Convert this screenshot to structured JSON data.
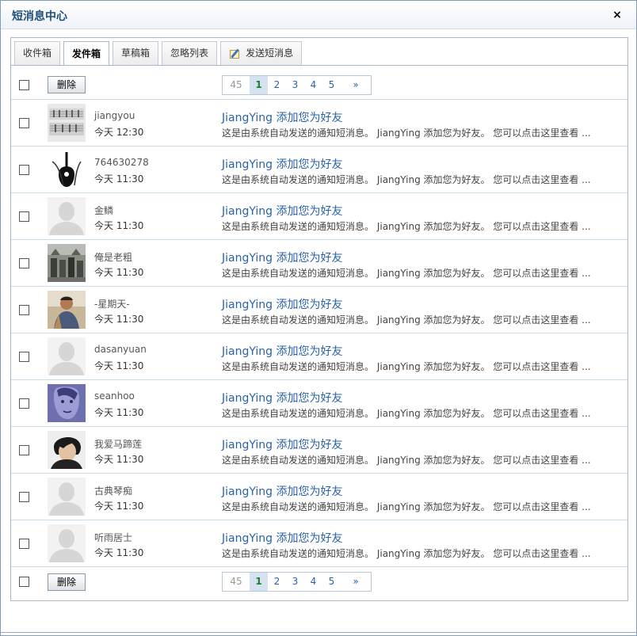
{
  "window": {
    "title": "短消息中心",
    "close_label": "×"
  },
  "tabs": [
    {
      "label": "收件箱",
      "active": false
    },
    {
      "label": "发件箱",
      "active": true
    },
    {
      "label": "草稿箱",
      "active": false
    },
    {
      "label": "忽略列表",
      "active": false
    },
    {
      "label": "发送短消息",
      "active": false,
      "icon": "compose-icon"
    }
  ],
  "toolbar": {
    "delete_label": "删除"
  },
  "pager": {
    "total": "45",
    "pages": [
      "1",
      "2",
      "3",
      "4",
      "5"
    ],
    "current": "1",
    "next_label": "»"
  },
  "messages": [
    {
      "avatar": "photo-sheet-music",
      "username": "jiangyou",
      "time": "今天 12:30",
      "subject": "JiangYing 添加您为好友",
      "snippet": "这是由系统自动发送的通知短消息。 JiangYing 添加您为好友。 您可以点击这里查看 ..."
    },
    {
      "avatar": "photo-guitar",
      "username": "764630278",
      "time": "今天 11:30",
      "subject": "JiangYing 添加您为好友",
      "snippet": "这是由系统自动发送的通知短消息。 JiangYing 添加您为好友。 您可以点击这里查看 ..."
    },
    {
      "avatar": "default-avatar",
      "username": "金鳞",
      "time": "今天 11:30",
      "subject": "JiangYing 添加您为好友",
      "snippet": "这是由系统自动发送的通知短消息。 JiangYing 添加您为好友。 您可以点击这里查看 ..."
    },
    {
      "avatar": "photo-group",
      "username": "俺是老粗",
      "time": "今天 11:30",
      "subject": "JiangYing 添加您为好友",
      "snippet": "这是由系统自动发送的通知短消息。 JiangYing 添加您为好友。 您可以点击这里查看 ..."
    },
    {
      "avatar": "photo-person",
      "username": "-星期天-",
      "time": "今天 11:30",
      "subject": "JiangYing 添加您为好友",
      "snippet": "这是由系统自动发送的通知短消息。 JiangYing 添加您为好友。 您可以点击这里查看 ..."
    },
    {
      "avatar": "default-avatar",
      "username": "dasanyuan",
      "time": "今天 11:30",
      "subject": "JiangYing 添加您为好友",
      "snippet": "这是由系统自动发送的通知短消息。 JiangYing 添加您为好友。 您可以点击这里查看 ..."
    },
    {
      "avatar": "photo-drawing",
      "username": "seanhoo",
      "time": "今天 11:30",
      "subject": "JiangYing 添加您为好友",
      "snippet": "这是由系统自动发送的通知短消息。 JiangYing 添加您为好友。 您可以点击这里查看 ..."
    },
    {
      "avatar": "photo-portrait",
      "username": "我爱马蹄莲",
      "time": "今天 11:30",
      "subject": "JiangYing 添加您为好友",
      "snippet": "这是由系统自动发送的通知短消息。 JiangYing 添加您为好友。 您可以点击这里查看 ..."
    },
    {
      "avatar": "default-avatar",
      "username": "古典琴痴",
      "time": "今天 11:30",
      "subject": "JiangYing 添加您为好友",
      "snippet": "这是由系统自动发送的通知短消息。 JiangYing 添加您为好友。 您可以点击这里查看 ..."
    },
    {
      "avatar": "default-avatar",
      "username": "听雨居士",
      "time": "今天 11:30",
      "subject": "JiangYing 添加您为好友",
      "snippet": "这是由系统自动发送的通知短消息。 JiangYing 添加您为好友。 您可以点击这里查看 ..."
    }
  ]
}
